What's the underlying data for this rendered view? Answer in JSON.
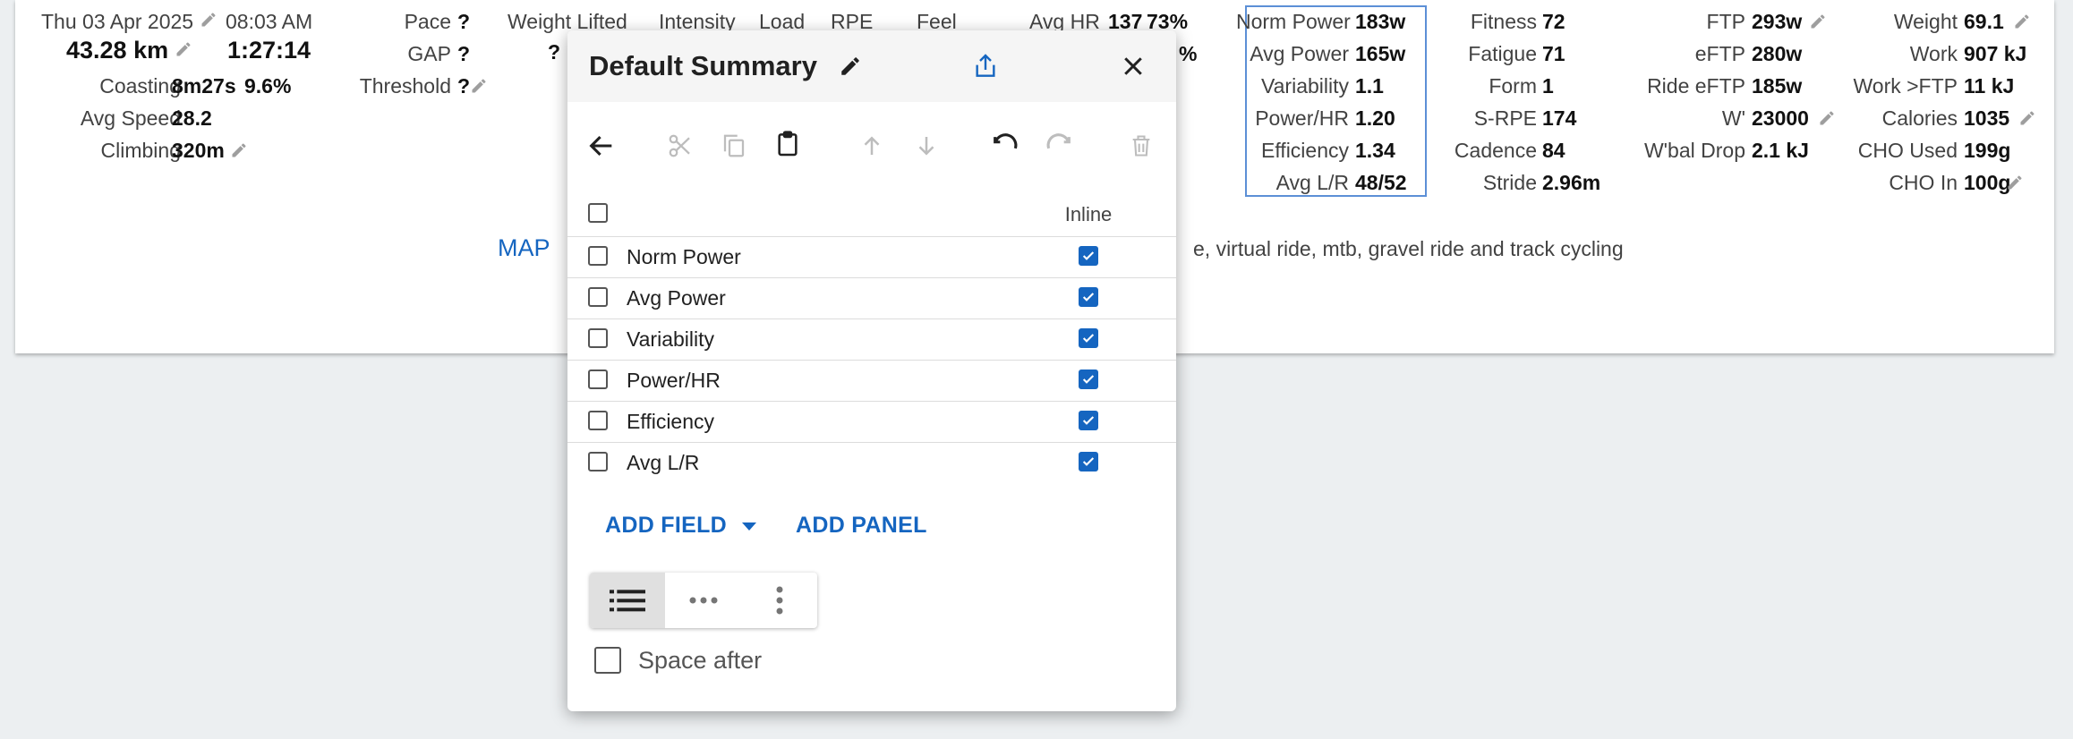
{
  "summary": {
    "date": "Thu 03 Apr 2025",
    "time": "08:03 AM",
    "distance": "43.28 km",
    "duration": "1:27:14",
    "coasting_label": "Coasting",
    "coasting_value": "8m27s",
    "coasting_pct": "9.6%",
    "avg_speed_label": "Avg Speed",
    "avg_speed_value": "28.2",
    "climbing_label": "Climbing",
    "climbing_value": "320m",
    "pace_label": "Pace",
    "pace_value": "?",
    "gap_label": "GAP",
    "gap_value": "?",
    "threshold_label": "Threshold",
    "threshold_value": "?",
    "weight_lifted_label": "Weight Lifted",
    "weight_lifted_value": "?",
    "intensity_label": "Intensity",
    "load_label": "Load",
    "rpe_label": "RPE",
    "feel_label": "Feel",
    "avg_hr_label": "Avg HR",
    "avg_hr_value": "137",
    "avg_hr_pct": "73%",
    "hidden_pct_fragment": "%",
    "power": [
      {
        "label": "Norm Power",
        "value": "183w"
      },
      {
        "label": "Avg Power",
        "value": "165w"
      },
      {
        "label": "Variability",
        "value": "1.1"
      },
      {
        "label": "Power/HR",
        "value": "1.20"
      },
      {
        "label": "Efficiency",
        "value": "1.34"
      },
      {
        "label": "Avg L/R",
        "value": "48/52"
      }
    ],
    "fitness": [
      {
        "label": "Fitness",
        "value": "72"
      },
      {
        "label": "Fatigue",
        "value": "71"
      },
      {
        "label": "Form",
        "value": "1"
      },
      {
        "label": "S-RPE",
        "value": "174"
      },
      {
        "label": "Cadence",
        "value": "84"
      },
      {
        "label": "Stride",
        "value": "2.96m"
      }
    ],
    "ftp": [
      {
        "label": "FTP",
        "value": "293w"
      },
      {
        "label": "eFTP",
        "value": "280w"
      },
      {
        "label": "Ride eFTP",
        "value": "185w"
      },
      {
        "label": "W'",
        "value": "23000"
      },
      {
        "label": "W'bal Drop",
        "value": "2.1 kJ"
      }
    ],
    "weight": [
      {
        "label": "Weight",
        "value": "69.1"
      },
      {
        "label": "Work",
        "value": "907 kJ"
      },
      {
        "label": "Work >FTP",
        "value": "11 kJ"
      },
      {
        "label": "Calories",
        "value": "1035"
      },
      {
        "label": "CHO Used",
        "value": "199g"
      },
      {
        "label": "CHO In",
        "value": "100g"
      }
    ],
    "map_label": "MAP",
    "description_fragment": "e, virtual ride, mtb, gravel ride and track cycling"
  },
  "dialog": {
    "title": "Default Summary",
    "inline_header": "Inline",
    "rows": [
      {
        "label": "Norm Power",
        "inline": true
      },
      {
        "label": "Avg Power",
        "inline": true
      },
      {
        "label": "Variability",
        "inline": true
      },
      {
        "label": "Power/HR",
        "inline": true
      },
      {
        "label": "Efficiency",
        "inline": true
      },
      {
        "label": "Avg L/R",
        "inline": true
      }
    ],
    "add_field_label": "ADD FIELD",
    "add_panel_label": "ADD PANEL",
    "space_after_label": "Space after",
    "space_after_checked": false,
    "layout_selected": "list",
    "icons": {
      "edit": "pencil-icon",
      "share": "share-icon",
      "close": "close-icon",
      "back": "arrow-back-icon",
      "cut": "scissors-icon",
      "copy": "copy-icon",
      "paste": "clipboard-icon",
      "up": "arrow-up-icon",
      "down": "arrow-down-icon",
      "undo": "undo-icon",
      "redo": "redo-icon",
      "delete": "trash-icon",
      "layout_list": "list-icon",
      "layout_inline": "horizontal-dots-icon",
      "layout_menu": "vertical-dots-icon"
    }
  },
  "colors": {
    "accent": "#1565c0",
    "background": "#eceff1",
    "highlight_border": "#5c8fd6"
  }
}
